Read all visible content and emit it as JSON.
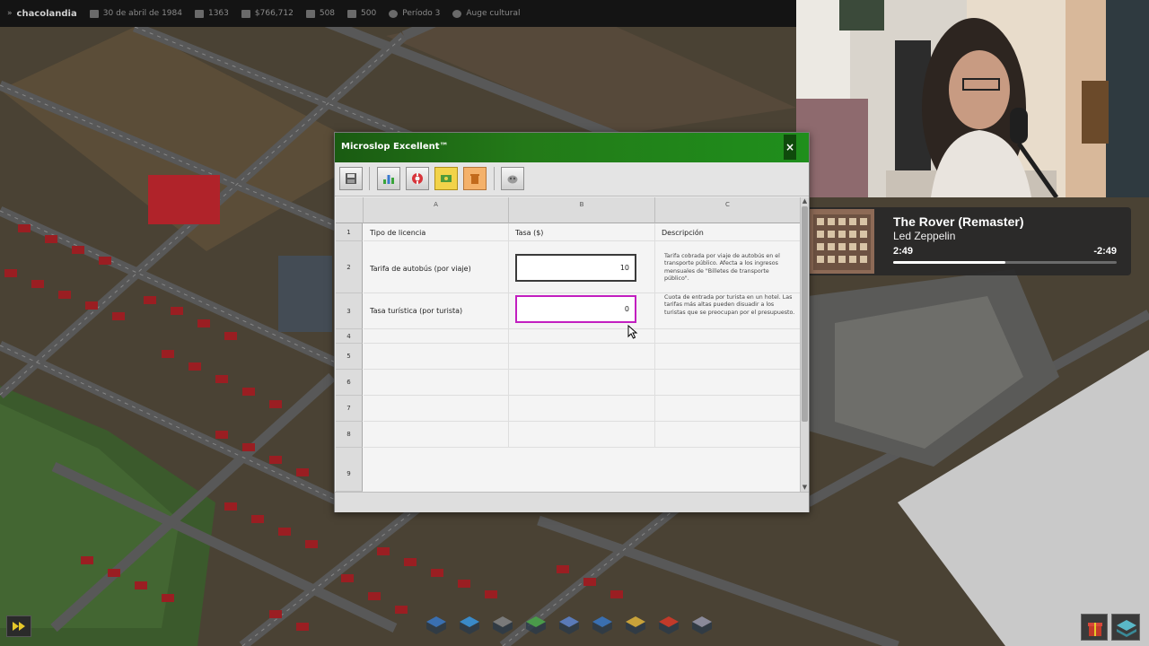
{
  "topbar": {
    "city_name": "chacolandia",
    "date": "30 de abril de 1984",
    "population": "1363",
    "money": "$766,712",
    "stat_a": "508",
    "stat_b": "500",
    "period": "Período 3",
    "status": "Auge cultural"
  },
  "window": {
    "title": "Microslop Excellent™",
    "close_label": "×",
    "toolbar": [
      {
        "name": "save-icon",
        "active": false
      },
      {
        "name": "chart-icon",
        "active": false
      },
      {
        "name": "lifebuoy-icon",
        "active": false
      },
      {
        "name": "money-icon",
        "active": true
      },
      {
        "name": "trash-icon",
        "active": false
      },
      {
        "name": "paint-icon",
        "active": false
      }
    ],
    "columns": [
      "A",
      "B",
      "C"
    ],
    "rows": [
      "1",
      "2",
      "3",
      "4",
      "5",
      "6",
      "7",
      "8",
      "9"
    ],
    "header_row": {
      "col_a": "Tipo de licencia",
      "col_b": "Tasa ($)",
      "col_c": "Descripción"
    },
    "licenses": [
      {
        "name": "Tarifa de autobús (por viaje)",
        "rate": "10",
        "description": "Tarifa cobrada por viaje de autobús en el transporte público. Afecta a los ingresos mensuales de \"Billetes de transporte público\"."
      },
      {
        "name": "Tasa turística (por turista)",
        "rate": "0",
        "description": "Cuota de entrada por turista en un hotel. Las tarifas más altas pueden disuadir a los turistas que se preocupan por el presupuesto."
      }
    ]
  },
  "now_playing": {
    "title": "The Rover (Remaster)",
    "artist": "Led Zeppelin",
    "elapsed": "2:49",
    "remaining": "-2:49",
    "progress": 0.5
  },
  "bottom_toolbar": [
    "house-icon",
    "building-icon",
    "road-icon",
    "tree-icon",
    "office-icon",
    "services-icon",
    "industry-icon",
    "gift-icon",
    "train-icon"
  ],
  "colors": {
    "title_green": "#1f8f1c",
    "focus_border": "#c21fc0",
    "active_tool": "#f2d34a"
  }
}
